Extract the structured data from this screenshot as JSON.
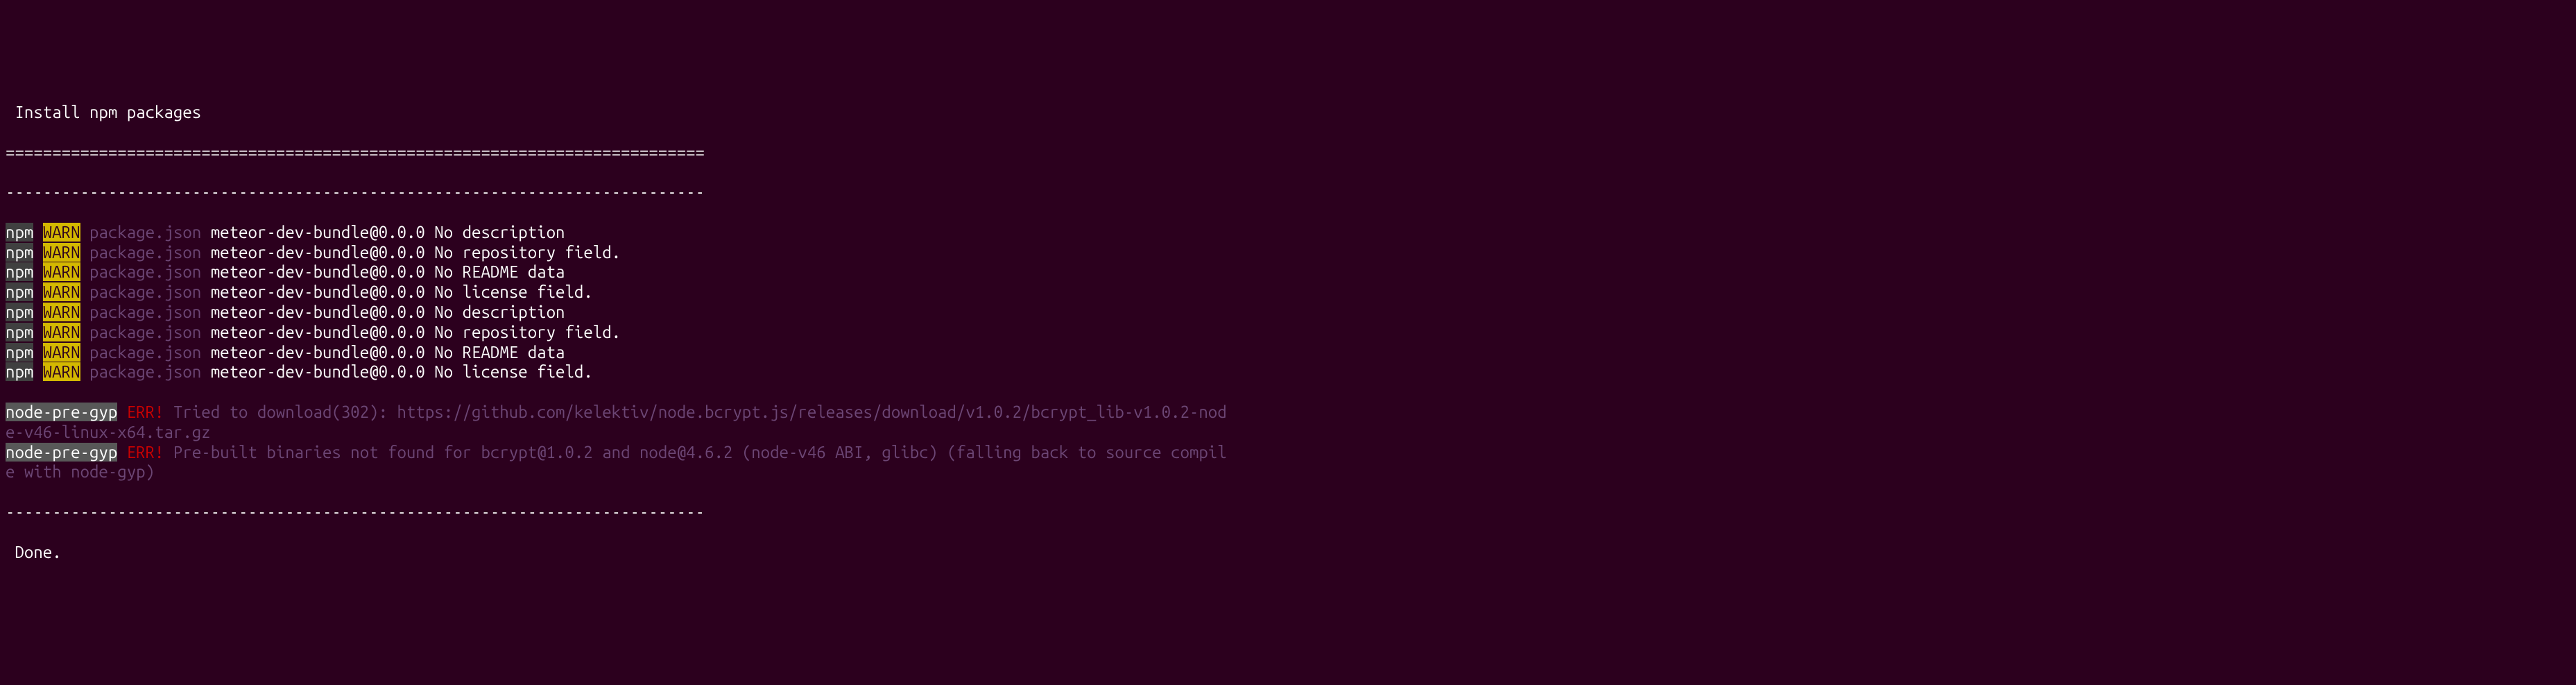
{
  "header": {
    "title": " Install npm packages",
    "separator_equals": "===========================================================================",
    "separator_dashes": "---------------------------------------------------------------------------"
  },
  "npm_warnings": [
    {
      "tool": "npm",
      "level": "WARN",
      "source": "package.json",
      "msg": "meteor-dev-bundle@0.0.0 No description"
    },
    {
      "tool": "npm",
      "level": "WARN",
      "source": "package.json",
      "msg": "meteor-dev-bundle@0.0.0 No repository field."
    },
    {
      "tool": "npm",
      "level": "WARN",
      "source": "package.json",
      "msg": "meteor-dev-bundle@0.0.0 No README data"
    },
    {
      "tool": "npm",
      "level": "WARN",
      "source": "package.json",
      "msg": "meteor-dev-bundle@0.0.0 No license field."
    },
    {
      "tool": "npm",
      "level": "WARN",
      "source": "package.json",
      "msg": "meteor-dev-bundle@0.0.0 No description"
    },
    {
      "tool": "npm",
      "level": "WARN",
      "source": "package.json",
      "msg": "meteor-dev-bundle@0.0.0 No repository field."
    },
    {
      "tool": "npm",
      "level": "WARN",
      "source": "package.json",
      "msg": "meteor-dev-bundle@0.0.0 No README data"
    },
    {
      "tool": "npm",
      "level": "WARN",
      "source": "package.json",
      "msg": "meteor-dev-bundle@0.0.0 No license field."
    }
  ],
  "node_pre_gyp": [
    {
      "tool": "node-pre-gyp",
      "level": "ERR!",
      "msg_line1": "Tried to download(302): https://github.com/kelektiv/node.bcrypt.js/releases/download/v1.0.2/bcrypt_lib-v1.0.2-nod",
      "msg_line2": "e-v46-linux-x64.tar.gz"
    },
    {
      "tool": "node-pre-gyp",
      "level": "ERR!",
      "msg_line1": "Pre-built binaries not found for bcrypt@1.0.2 and node@4.6.2 (node-v46 ABI, glibc) (falling back to source compil",
      "msg_line2": "e with node-gyp)"
    }
  ],
  "footer": {
    "done": " Done."
  }
}
